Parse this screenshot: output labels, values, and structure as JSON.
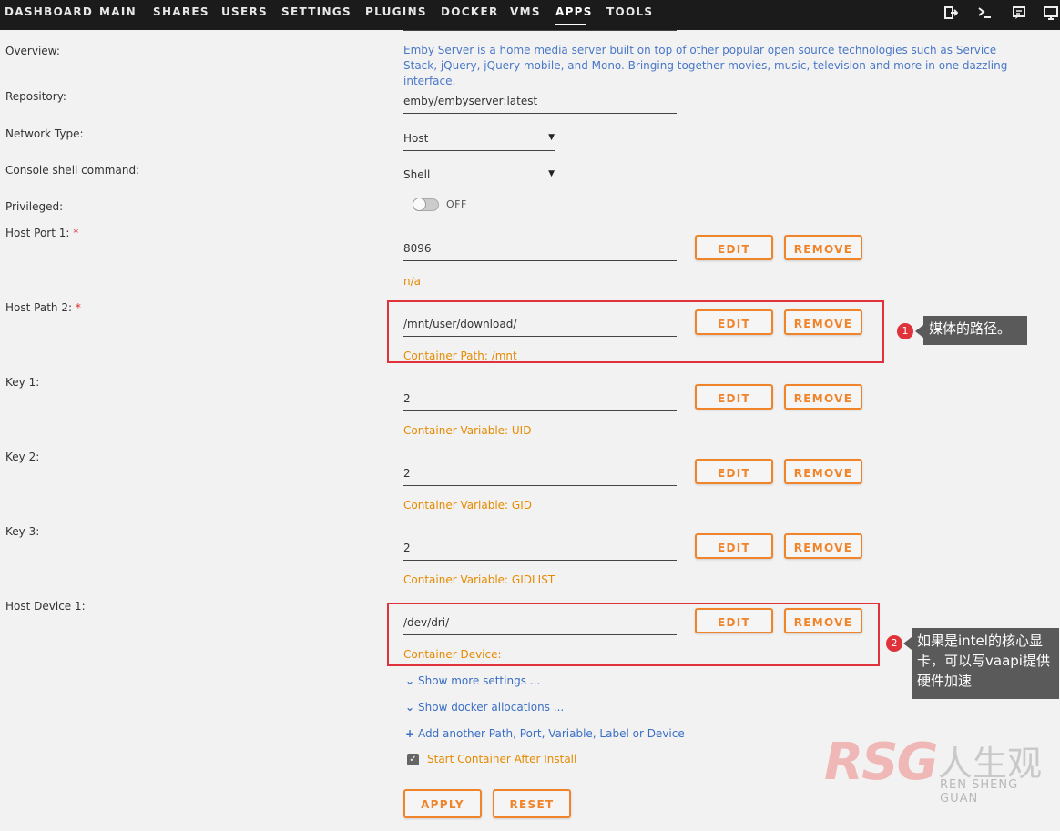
{
  "nav": {
    "items": [
      "DASHBOARD",
      "MAIN",
      "SHARES",
      "USERS",
      "SETTINGS",
      "PLUGINS",
      "DOCKER",
      "VMS",
      "APPS",
      "TOOLS"
    ],
    "active": "APPS",
    "icons": [
      "logout-icon",
      "terminal-icon",
      "feedback-icon",
      "monitor-icon"
    ]
  },
  "form": {
    "overview_label": "Overview:",
    "overview_text": "Emby Server is a home media server built on top of other popular open source technologies such as Service Stack, jQuery, jQuery mobile, and Mono. Bringing together movies, music, television and more in one dazzling interface.",
    "repository_label": "Repository:",
    "repository_value": "emby/embyserver:latest",
    "network_label": "Network Type:",
    "network_value": "Host",
    "console_label": "Console shell command:",
    "console_value": "Shell",
    "privileged_label": "Privileged:",
    "privileged_state": "OFF",
    "host_port_label": "Host Port 1:",
    "host_port_value": "8096",
    "host_port_hint": "n/a",
    "host_path_label": "Host Path 2:",
    "host_path_value": "/mnt/user/download/",
    "host_path_hint": "Container Path: /mnt",
    "key1_label": "Key 1:",
    "key1_value": "2",
    "key1_hint": "Container Variable: UID",
    "key2_label": "Key 2:",
    "key2_value": "2",
    "key2_hint": "Container Variable: GID",
    "key3_label": "Key 3:",
    "key3_value": "2",
    "key3_hint": "Container Variable: GIDLIST",
    "device_label": "Host Device 1:",
    "device_value": "/dev/dri/",
    "device_hint": "Container Device:",
    "required_mark": "*"
  },
  "buttons": {
    "edit": "EDIT",
    "remove": "REMOVE",
    "apply": "APPLY",
    "reset": "RESET"
  },
  "links": {
    "more_settings": "Show more settings ...",
    "docker_alloc": "Show docker allocations ...",
    "add_another": "Add another Path, Port, Variable, Label or Device"
  },
  "start_after_install": {
    "label": "Start Container After Install",
    "checked": true
  },
  "annotations": [
    {
      "number": "1",
      "text": "媒体的路径。"
    },
    {
      "number": "2",
      "text": "如果是intel的核心显卡，可以写vaapi提供硬件加速"
    }
  ],
  "watermark": {
    "logo": "RSG",
    "cn": "人生观",
    "en": "REN SHENG GUAN"
  },
  "colors": {
    "accent": "#f0842a",
    "hint": "#e68a00",
    "link": "#3b6fc4",
    "annotation_red": "#e0323a",
    "nav_bg": "#1c1b1b"
  }
}
